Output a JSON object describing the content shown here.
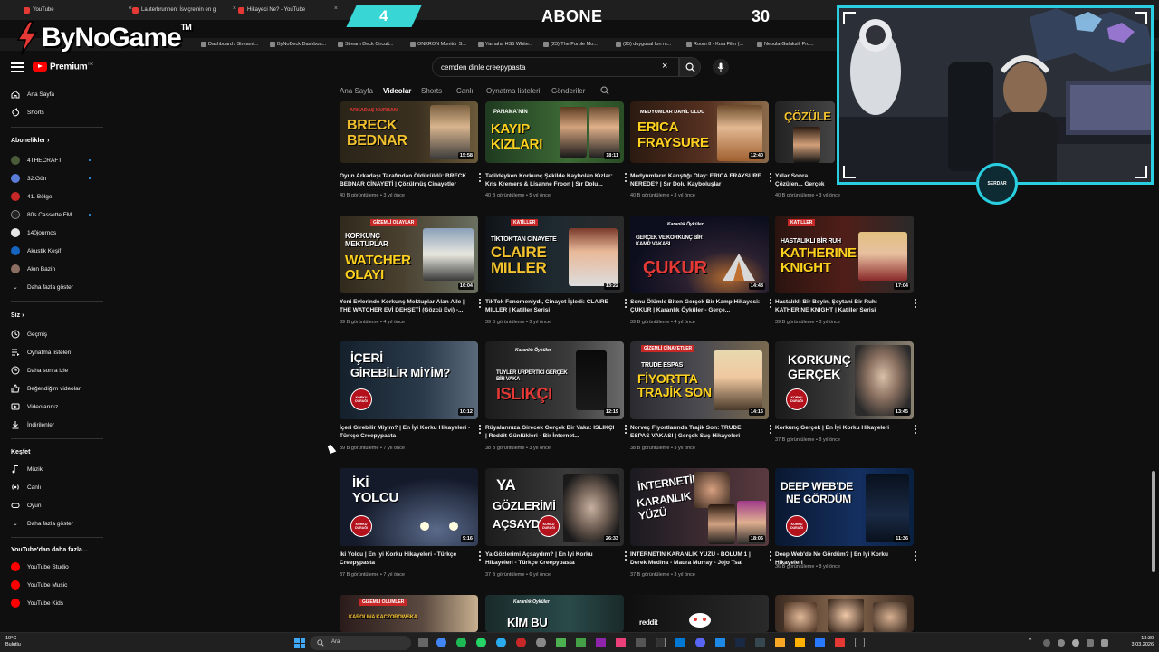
{
  "browser": {
    "tabs": [
      {
        "label": "YouTube"
      },
      {
        "label": "Lauterbrunnen: İsviçre'nin en g"
      },
      {
        "label": "Hikayeci Ne? - YouTube"
      },
      {
        "label": ""
      }
    ],
    "bookmarks": [
      "Dashboard / Streamt...",
      "ByNoDeck Dashboa...",
      "Stream Deck Circuit...",
      "ONKRON Monitör S...",
      "Yamaha HS5 White...",
      "(23) The Purple Mo...",
      "(25) duygusal fon m...",
      "Room 8 - Kısa Film (...",
      "Nebula-Galaksili Pro..."
    ]
  },
  "overlay": {
    "logo": "ByNoGame",
    "logo_tm": "TM",
    "counter_number": "4",
    "abone_label": "ABONE",
    "abone_goal": "30",
    "badge_text": "SERDAR"
  },
  "youtube": {
    "brand": "Premium",
    "brand_sup": "TR",
    "search_value": "cemden dinle creepypasta",
    "channel_tabs": [
      "Ana Sayfa",
      "Videolar",
      "Shorts",
      "Canlı",
      "Oynatma listeleri",
      "Gönderiler"
    ],
    "active_tab": "Videolar"
  },
  "sidebar": {
    "main": [
      "Ana Sayfa",
      "Shorts"
    ],
    "subs_header": "Abonelikler",
    "subs": [
      "4THECRAFT",
      "32.Gün",
      "41. Bölge",
      "80s Cassette FM",
      "140journos",
      "Akustik Keşif",
      "Akın Bazin",
      "Daha fazla göster"
    ],
    "you_header": "Siz",
    "you": [
      "Geçmiş",
      "Oynatma listeleri",
      "Daha sonra izle",
      "Beğendiğim videolar",
      "Videolarınız",
      "İndirilenler"
    ],
    "explore_header": "Keşfet",
    "explore": [
      "Müzik",
      "Canlı",
      "Oyun",
      "Daha fazla göster"
    ],
    "more_header": "YouTube'dan daha fazla...",
    "more": [
      "YouTube Studio",
      "YouTube Music",
      "YouTube Kids"
    ]
  },
  "videos": [
    {
      "title": "Oyun Arkadaşı Tarafından Öldürüldü: BRECK BEDNAR CİNAYETİ | Çözülmüş Cinayetler",
      "meta": "40 B görüntüleme • 3 yıl önce",
      "duration": "15:58",
      "thumb_top": "ARKADAŞ KURBANI",
      "thumb_main": "BRECK BEDNAR"
    },
    {
      "title": "Tatildeyken Korkunç Şekilde Kaybolan Kızlar: Kris Kremers & Lisanne Froon | Sır Dolu...",
      "meta": "40 B görüntüleme • 5 yıl önce",
      "duration": "18:11",
      "thumb_top": "PANAMA'NIN",
      "thumb_main": "KAYIP KIZLARI"
    },
    {
      "title": "Medyumların Karıştığı Olay: ERICA FRAYSURE NEREDE? | Sır Dolu Kayboluşlar",
      "meta": "40 B görüntüleme • 3 yıl önce",
      "duration": "12:40",
      "thumb_top": "MEDYUMLAR DAHİL OLDU",
      "thumb_main": "ERICA FRAYSURE"
    },
    {
      "title": "Yıllar Sonra Çözülen... Gerçek Suç Vakası",
      "meta": "40 B görüntüleme • 3 yıl önce",
      "duration": "",
      "thumb_top": "",
      "thumb_main": "ÇÖZÜLE"
    },
    {
      "title": "Yeni Evlerinde Korkunç Mektuplar Alan Aile | THE WATCHER EVİ DEHŞETİ (Gözcü Evi) -...",
      "meta": "39 B görüntüleme • 4 yıl önce",
      "duration": "16:04",
      "thumb_top": "KORKUNÇ MEKTUPLAR",
      "thumb_main": "WATCHER OLAYI",
      "tag": "GİZEMLİ OLAYLAR"
    },
    {
      "title": "TikTok Fenomeniydi, Cinayet İşledi: CLAIRE MILLER | Katiller Serisi",
      "meta": "39 B görüntüleme • 3 yıl önce",
      "duration": "13:22",
      "thumb_top": "TİKTOK'TAN CİNAYETE",
      "thumb_main": "CLAIRE MILLER",
      "tag": "KATİLLER"
    },
    {
      "title": "Sonu Ölümle Biten Gerçek Bir Kamp Hikayesi: ÇUKUR | Karanlık Öyküler - Gerçe...",
      "meta": "39 B görüntüleme • 4 yıl önce",
      "duration": "14:48",
      "thumb_top": "GERÇEK VE KORKUNÇ BİR KAMP VAKASI",
      "thumb_main": "ÇUKUR",
      "tag": "Karanlık Öyküler"
    },
    {
      "title": "Hastalıklı Bir Beyin, Şeytani Bir Ruh: KATHERINE KNIGHT | Katiller Serisi",
      "meta": "39 B görüntüleme • 3 yıl önce",
      "duration": "17:04",
      "thumb_top": "HASTALIKLI BİR RUH",
      "thumb_main": "KATHERINE KNIGHT",
      "tag": "KATİLLER"
    },
    {
      "title": "İçeri Girebilir Miyim? | En İyi Korku Hikayeleri - Türkçe Creepypasta",
      "meta": "39 B görüntüleme • 7 yıl önce",
      "duration": "10:12",
      "thumb_top": "İÇERİ",
      "thumb_main": "GİREBİLİR MİYİM?",
      "badge": "KORKU DURAĞI"
    },
    {
      "title": "Rüyalarınıza Girecek Gerçek Bir Vaka: ISLIKÇI | Reddit Günlükleri - Bir İnternet...",
      "meta": "38 B görüntüleme • 3 yıl önce",
      "duration": "12:19",
      "thumb_top": "TÜYLER ÜRPERTİCİ GERÇEK BİR VAKA",
      "thumb_main": "ISLIKÇI",
      "tag": "Karanlık Öyküler"
    },
    {
      "title": "Norveç Fiyortlarında Trajik Son: TRUDE ESPAS VAKASI | Gerçek Suç Hikayeleri",
      "meta": "38 B görüntüleme • 3 yıl önce",
      "duration": "14:16",
      "thumb_top": "TRUDE ESPAS",
      "thumb_main": "FİYORTTA TRAJİK SON",
      "tag": "GİZEMLİ CİNAYETLER"
    },
    {
      "title": "Korkunç Gerçek | En İyi Korku Hikayeleri",
      "meta": "37 B görüntüleme • 8 yıl önce",
      "duration": "13:45",
      "thumb_top": "KORKUNÇ",
      "thumb_main": "GERÇEK",
      "badge": "KORKU DURAĞI"
    },
    {
      "title": "İki Yolcu | En İyi Korku Hikayeleri - Türkçe Creepypasta",
      "meta": "37 B görüntüleme • 7 yıl önce",
      "duration": "9:16",
      "thumb_top": "İKİ",
      "thumb_main": "YOLCU",
      "badge": "KORKU DURAĞI"
    },
    {
      "title": "Ya Gözlerimi Açsaydım? | En İyi Korku Hikayeleri - Türkçe Creepypasta",
      "meta": "37 B görüntüleme • 6 yıl önce",
      "duration": "26:33",
      "thumb_top": "YA",
      "thumb_main": "GÖZLERİMİ AÇSAYDIM",
      "badge": "KORKU DURAĞI"
    },
    {
      "title": "İNTERNETİN KARANLIK YÜZÜ - BÖLÜM 1 | Derek Medina - Maura Murray - Jojo Tsai",
      "meta": "37 B görüntüleme • 3 yıl önce",
      "duration": "18:06",
      "thumb_top": "İNTERNETİN",
      "thumb_main": "KARANLIK YÜZÜ"
    },
    {
      "title": "Deep Web'de Ne Gördüm? | En İyi Korku Hikayeleri",
      "meta": "36 B görüntüleme • 8 yıl önce",
      "duration": "11:36",
      "thumb_top": "DEEP WEB'DE",
      "thumb_main": "NE GÖRDÜM",
      "badge": "KORKU DURAĞI"
    },
    {
      "title": "",
      "meta": "",
      "duration": "",
      "thumb_top": "KAROLINA KACZOROWSKA",
      "thumb_main": "",
      "tag": "GİZEMLİ ÖLÜMLER"
    },
    {
      "title": "",
      "meta": "",
      "duration": "",
      "thumb_top": "",
      "thumb_main": "KİM BU",
      "tag": "Karanlık Öyküler"
    },
    {
      "title": "",
      "meta": "",
      "duration": "",
      "thumb_top": "reddit",
      "thumb_main": ""
    },
    {
      "title": "",
      "meta": "",
      "duration": "",
      "thumb_top": "",
      "thumb_main": ""
    }
  ],
  "taskbar": {
    "weather_temp": "10°C",
    "weather_text": "Bulutlu",
    "search_placeholder": "Ara",
    "time": "13:30",
    "date": "3.03.2026"
  },
  "colors": {
    "accent_cyan": "#29cfe0",
    "youtube_red": "#ff0000",
    "thumb_yellow": "#f2c12e"
  }
}
